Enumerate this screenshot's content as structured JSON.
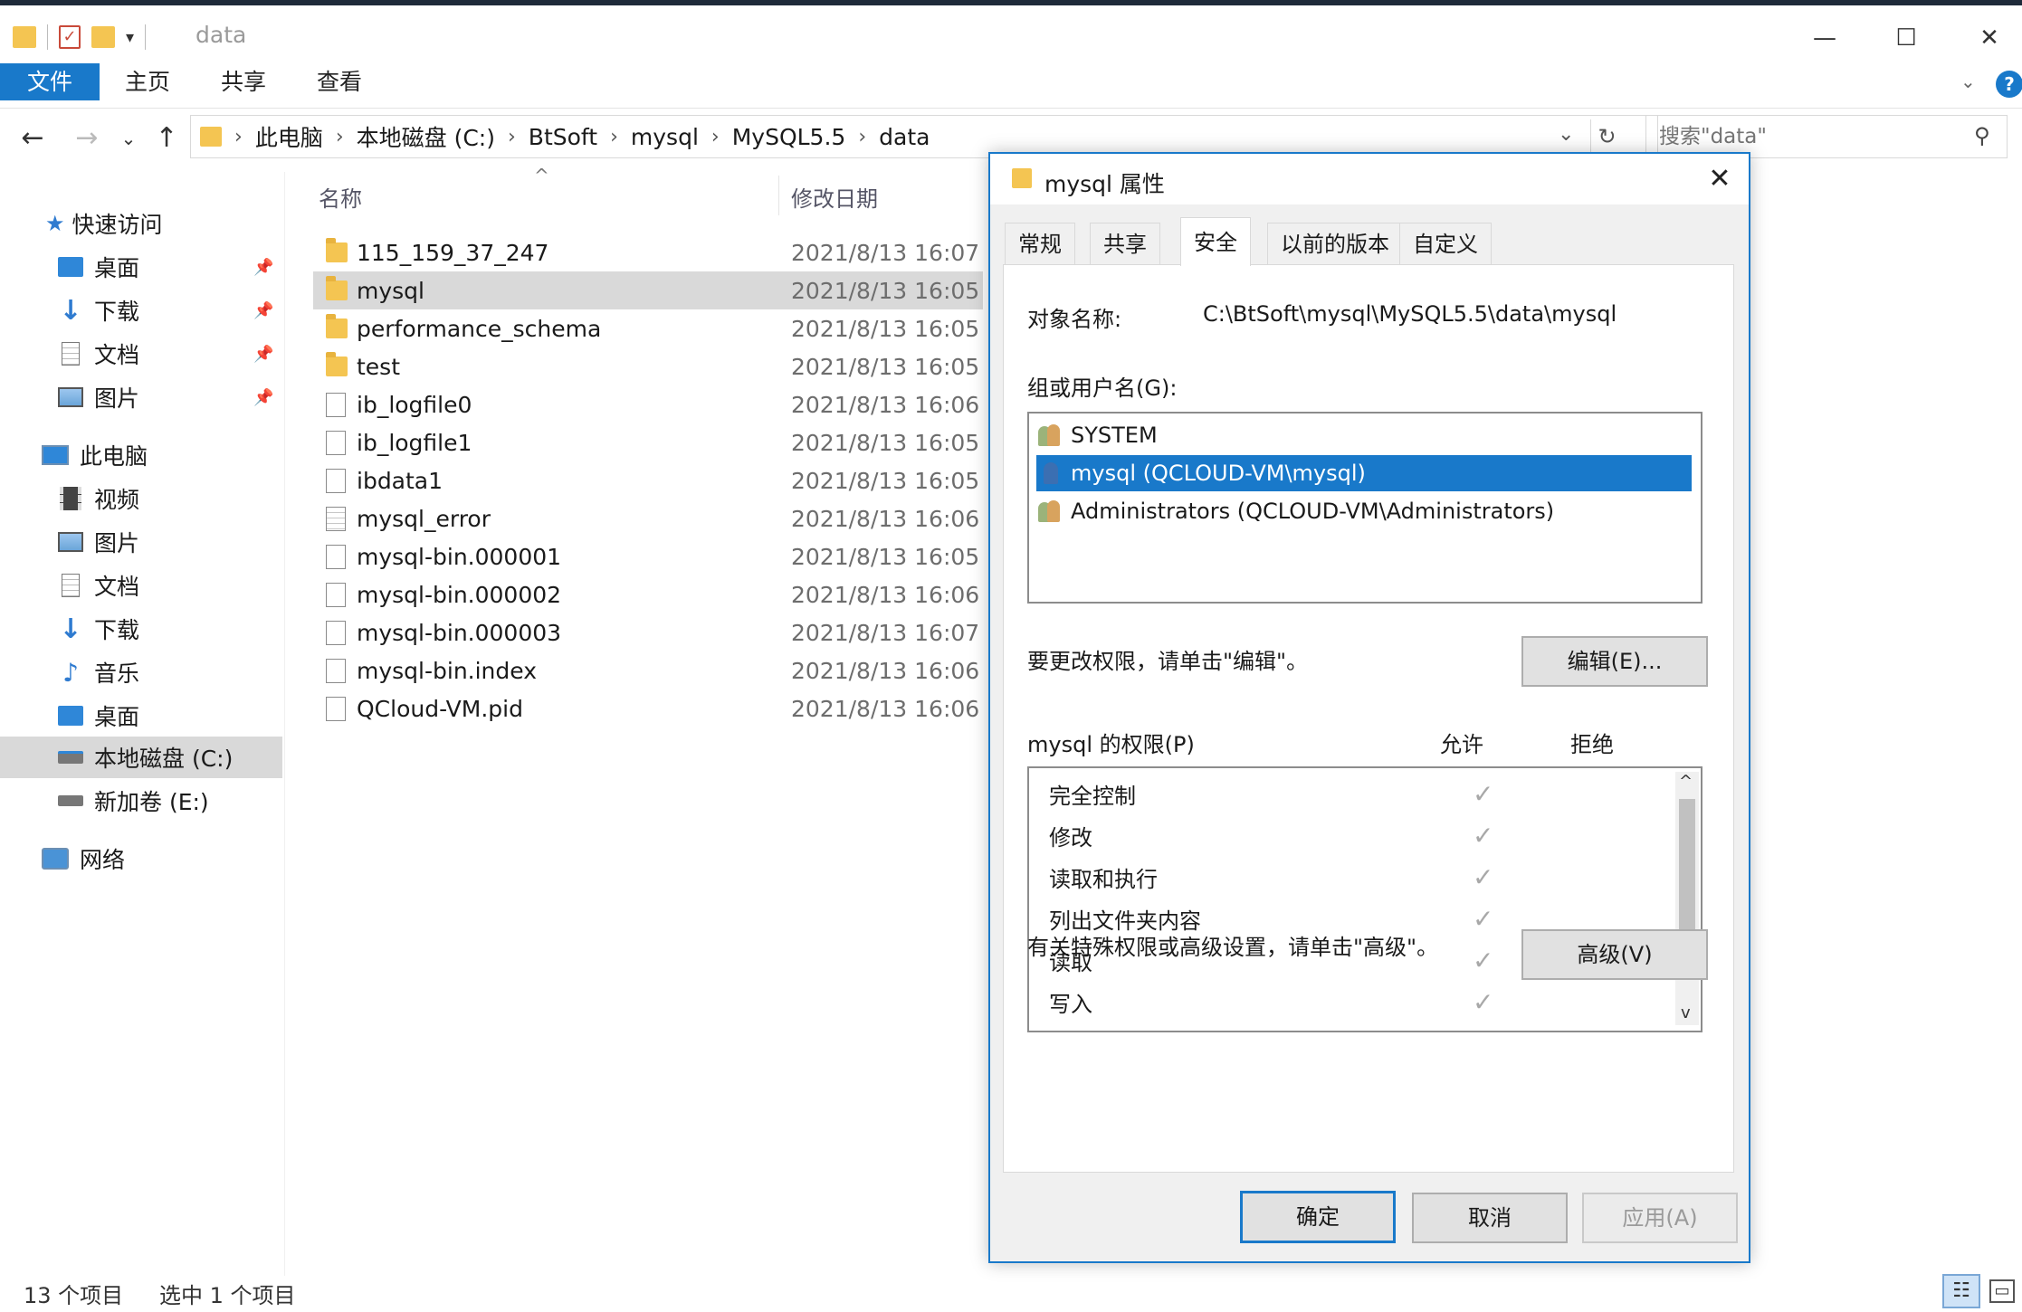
{
  "window": {
    "title": "data",
    "min_glyph": "—",
    "max_glyph": "☐",
    "close_glyph": "✕"
  },
  "ribbon": {
    "file_tab": "文件",
    "tabs": [
      "主页",
      "共享",
      "查看"
    ],
    "help_glyph": "?"
  },
  "nav_buttons": {
    "back": "←",
    "forward": "→",
    "recent": "⌄",
    "up": "↑"
  },
  "address": {
    "crumbs": [
      "此电脑",
      "本地磁盘 (C:)",
      "BtSoft",
      "mysql",
      "MySQL5.5",
      "data"
    ],
    "separator": "›",
    "refresh_glyph": "↻",
    "dropdown_glyph": "⌄"
  },
  "search": {
    "placeholder": "搜索\"data\"",
    "icon_glyph": "⚲"
  },
  "navpane": {
    "quick_access": "快速访问",
    "quick_items": [
      "桌面",
      "下载",
      "文档",
      "图片"
    ],
    "this_pc": "此电脑",
    "pc_items": [
      "视频",
      "图片",
      "文档",
      "下载",
      "音乐",
      "桌面",
      "本地磁盘 (C:)",
      "新加卷 (E:)"
    ],
    "network": "网络",
    "pin_glyph": "📌"
  },
  "filelist": {
    "col_name": "名称",
    "col_date": "修改日期",
    "sort_glyph": "^",
    "files": [
      {
        "name": "115_159_37_247",
        "date": "2021/8/13 16:07",
        "type": "folder"
      },
      {
        "name": "mysql",
        "date": "2021/8/13 16:05",
        "type": "folder"
      },
      {
        "name": "performance_schema",
        "date": "2021/8/13 16:05",
        "type": "folder"
      },
      {
        "name": "test",
        "date": "2021/8/13 16:05",
        "type": "folder"
      },
      {
        "name": "ib_logfile0",
        "date": "2021/8/13 16:06",
        "type": "file"
      },
      {
        "name": "ib_logfile1",
        "date": "2021/8/13 16:05",
        "type": "file"
      },
      {
        "name": "ibdata1",
        "date": "2021/8/13 16:05",
        "type": "file"
      },
      {
        "name": "mysql_error",
        "date": "2021/8/13 16:06",
        "type": "text"
      },
      {
        "name": "mysql-bin.000001",
        "date": "2021/8/13 16:05",
        "type": "file"
      },
      {
        "name": "mysql-bin.000002",
        "date": "2021/8/13 16:06",
        "type": "file"
      },
      {
        "name": "mysql-bin.000003",
        "date": "2021/8/13 16:07",
        "type": "file"
      },
      {
        "name": "mysql-bin.index",
        "date": "2021/8/13 16:06",
        "type": "file"
      },
      {
        "name": "QCloud-VM.pid",
        "date": "2021/8/13 16:06",
        "type": "file"
      }
    ]
  },
  "statusbar": {
    "count": "13 个项目",
    "selected": "选中 1 个项目"
  },
  "dialog": {
    "title": "mysql 属性",
    "close_glyph": "✕",
    "tabs": [
      "常规",
      "共享",
      "安全",
      "以前的版本",
      "自定义"
    ],
    "object_label": "对象名称:",
    "object_value": "C:\\BtSoft\\mysql\\MySQL5.5\\data\\mysql",
    "group_label": "组或用户名(G):",
    "principals": [
      "SYSTEM",
      "mysql (QCLOUD-VM\\mysql)",
      "Administrators (QCLOUD-VM\\Administrators)"
    ],
    "edit_hint": "要更改权限，请单击\"编辑\"。",
    "edit_button": "编辑(E)...",
    "perm_label": "mysql 的权限(P)",
    "allow_label": "允许",
    "deny_label": "拒绝",
    "permissions": [
      "完全控制",
      "修改",
      "读取和执行",
      "列出文件夹内容",
      "读取",
      "写入"
    ],
    "check_glyph": "✓",
    "scroll_up": "^",
    "scroll_down": "v",
    "advanced_hint": "有关特殊权限或高级设置，请单击\"高级\"。",
    "advanced_button": "高级(V)",
    "ok_button": "确定",
    "cancel_button": "取消",
    "apply_button": "应用(A)"
  }
}
